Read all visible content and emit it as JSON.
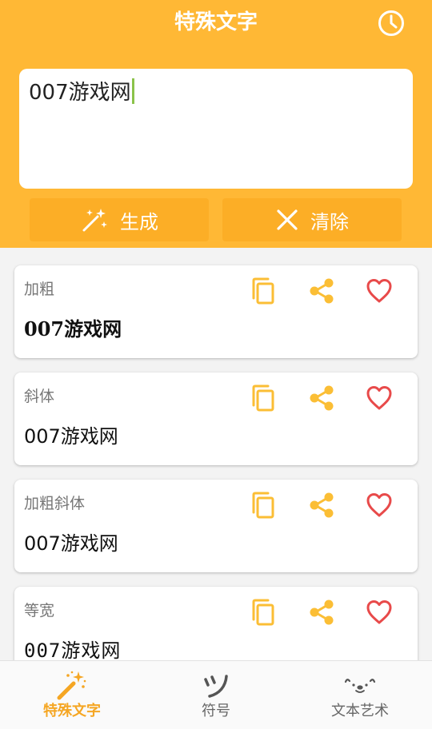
{
  "header": {
    "title": "特殊文字"
  },
  "input": {
    "value": "007游戏网"
  },
  "actions": {
    "generate_label": "生成",
    "clear_label": "清除"
  },
  "results": [
    {
      "label": "加粗",
      "text": "007游戏网",
      "style": "bold"
    },
    {
      "label": "斜体",
      "text": "007游戏网",
      "style": "italic"
    },
    {
      "label": "加粗斜体",
      "text": "007游戏网",
      "style": "bold-italic"
    },
    {
      "label": "等宽",
      "text": "007游戏网",
      "style": "monospace"
    }
  ],
  "bottom_nav": {
    "items": [
      {
        "label": "特殊文字",
        "icon": "magic-wand-icon",
        "active": true
      },
      {
        "label": "符号",
        "icon": "tsu-symbol-icon",
        "active": false
      },
      {
        "label": "文本艺术",
        "icon": "kaomoji-face-icon",
        "active": false
      }
    ]
  },
  "colors": {
    "accent": "#FFB835",
    "button": "#FCAE26",
    "icon": "#FBBE35",
    "favorite": "#E84A4A",
    "caret": "#8BC34A",
    "active_tab": "#F5A623"
  }
}
